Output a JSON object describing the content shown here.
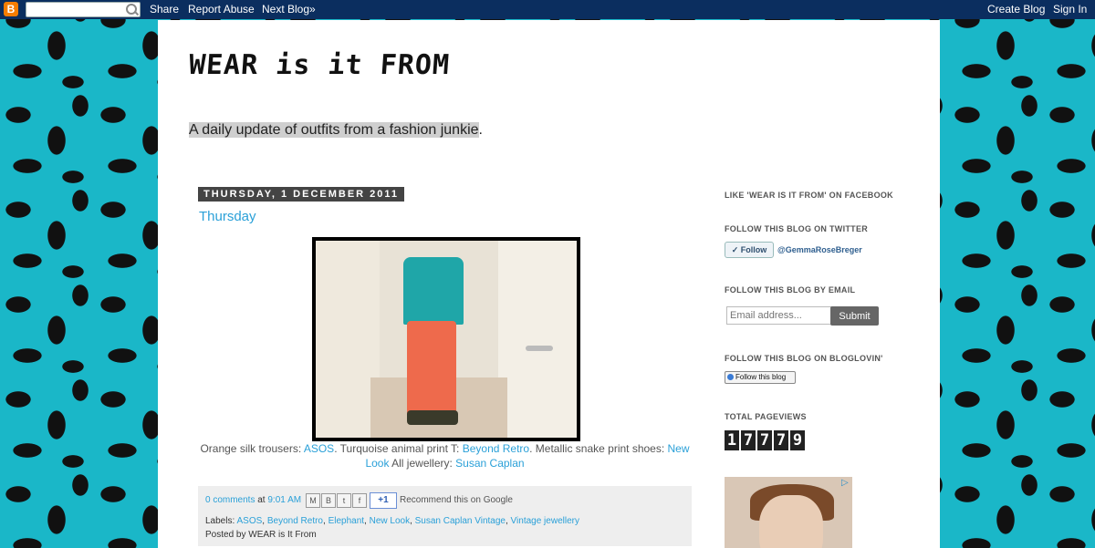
{
  "navbar": {
    "logo": "B",
    "search_value": "",
    "share": "Share",
    "report_abuse": "Report Abuse",
    "next_blog": "Next Blog»",
    "create_blog": "Create Blog",
    "sign_in": "Sign In"
  },
  "header": {
    "title": "WEAR is it FROM",
    "tagline_highlight": "A daily update of outfits from a fashion junkie",
    "tagline_end": "."
  },
  "post": {
    "date": "THURSDAY, 1 DECEMBER 2011",
    "title": "Thursday",
    "caption": [
      {
        "text": "Orange silk trousers: ",
        "link": false
      },
      {
        "text": "ASOS",
        "link": true
      },
      {
        "text": ". Turquoise animal print T: ",
        "link": false
      },
      {
        "text": "Beyond Retro",
        "link": true
      },
      {
        "text": ". Metallic snake print shoes: ",
        "link": false
      },
      {
        "text": "New Look",
        "link": true
      },
      {
        "text": " All jewellery: ",
        "link": false
      },
      {
        "text": "Susan Caplan",
        "link": true
      }
    ],
    "footer": {
      "comments": "0 comments",
      "at": " at ",
      "time": "9:01 AM",
      "share_icons": [
        "M",
        "B",
        "t",
        "f"
      ],
      "plusone": "+1",
      "recommend": "Recommend this on Google",
      "labels_prefix": "Labels: ",
      "labels": [
        "ASOS",
        "Beyond Retro",
        "Elephant",
        "New Look",
        "Susan Caplan Vintage",
        "Vintage jewellery"
      ],
      "posted_by": "Posted by WEAR is It From"
    }
  },
  "sidebar": {
    "facebook_title": "LIKE 'WEAR IS IT FROM' ON FACEBOOK",
    "twitter_title": "FOLLOW THIS BLOG ON TWITTER",
    "twitter_follow": "✓ Follow",
    "twitter_handle": "@GemmaRoseBreger",
    "email_title": "FOLLOW THIS BLOG BY EMAIL",
    "email_placeholder": "Email address...",
    "submit": "Submit",
    "bloglovin_title": "FOLLOW THIS BLOG ON BLOGLOVIN'",
    "bloglovin_follow": "Follow this blog",
    "pageviews_title": "TOTAL PAGEVIEWS",
    "pageviews_digits": [
      "1",
      "7",
      "7",
      "7",
      "9"
    ]
  },
  "colors": {
    "navbar_bg": "#0b2e5f",
    "link": "#2aa0d8",
    "background": "#1ab7c8"
  }
}
